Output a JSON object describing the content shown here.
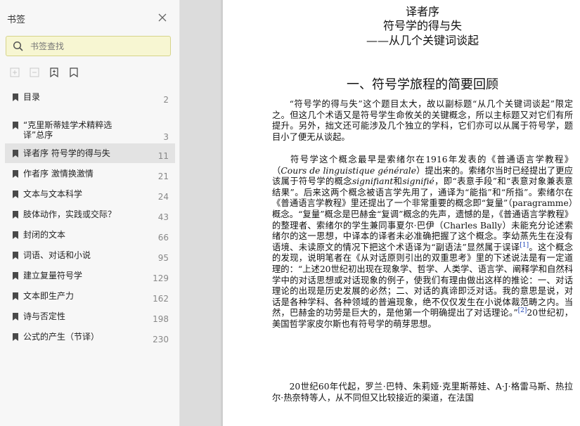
{
  "sidebar": {
    "title": "书签",
    "search_placeholder": "书签查找",
    "items": [
      {
        "label": "目录",
        "page": "2"
      },
      {
        "label": "“克里斯蒂娃学术精粹选译”总序",
        "page": "3"
      },
      {
        "label": "译者序 符号学的得与失",
        "page": "11",
        "selected": true
      },
      {
        "label": "作者序 激情换激情",
        "page": "21"
      },
      {
        "label": "文本与文本科学",
        "page": "24"
      },
      {
        "label": "肢体动作，实践或交际？",
        "page": "43"
      },
      {
        "label": "封闭的文本",
        "page": "66"
      },
      {
        "label": "词语、对话和小说",
        "page": "95"
      },
      {
        "label": "建立复量符号学",
        "page": "129"
      },
      {
        "label": "文本即生产力",
        "page": "162"
      },
      {
        "label": "诗与否定性",
        "page": "198"
      },
      {
        "label": "公式的产生（节译）",
        "page": "230"
      }
    ]
  },
  "document": {
    "title_line1": "译者序",
    "title_line2": "符号学的得与失",
    "title_line3": "——从几个关键词谈起",
    "section_title": "一、符号学旅程的简要回顾",
    "p1": "“符号学的得与失”这个题目太大，故以副标题“从几个关键词谈起”限定之。但这几个术语又是符号学生命攸关的关键概念，所以主标题又对它们有所提升。另外，拙文还可能涉及几个独立的学科，它们亦可以从属于符号学，题目小了便无从谈起。",
    "p2_a": "符号学这个概念最早是索绪尔在1916年发表的《普通语言学教程》（",
    "p2_i1": "Cours de linguistique générale",
    "p2_b": "）提出来的。索绪尔当时已经提出了更应该属于符号学的概念",
    "p2_i2": "signifiant",
    "p2_c": "和",
    "p2_i3": "signifié",
    "p2_d": "，即“表意手段”和“表意对象兼表意结果”。后来这两个概念被语言学先用了，通译为“能指”和“所指”。索绪尔在《普通语言学教程》里还提出了一个非常重要的概念即“复量”（paragramme）概念。“复量”概念是巴赫金“复调”概念的先声，遗憾的是，《普通语言学教程》的整理者、索绪尔的学生兼同事夏尔·巴伊（Charles Bally）未能充分论述索绪尔的这一思想，中译本的译者未必准确把握了这个概念。李幼蒸先生在没有语境、未读原文的情况下把这个术语译为“副语法”显然属于误译",
    "p2_fn1": "[1]",
    "p2_e": "。这个概念的发现，说明笔者在《从对话原则引出的双重思考》里的下述说法是有一定道理的：“上述20世纪初出现在现象学、哲学、人类学、语言学、阐释学和自然科学中的对话思想或对话现象的例子，使我们有理由做出这样的推论：一、对话理论的出现是历史发展的必然；二、对话的真谛即泛对话。我的意思是说，对话是各种学科、各种领域的普遍现象，绝不仅仅发生在小说体裁范畴之内。当然，巴赫金的功劳是巨大的，是他第一个明确提出了对话理论。”",
    "p2_fn2": "[2]",
    "p2_f": "20世纪初，美国哲学家皮尔斯也有符号学的萌芽思想。",
    "p3": "20世纪60年代起，罗兰·巴特、朱莉娅·克里斯蒂娃、A·J·格雷马斯、热拉尔·热奈特等人，从不同但又比较接近的渠道，在法国"
  },
  "colors": {
    "sidebar_bg": "#f7f7f7",
    "search_bg": "#f7f6d2",
    "selected_bg": "#e3e3e3",
    "footnote_link": "#1a3fb5"
  }
}
